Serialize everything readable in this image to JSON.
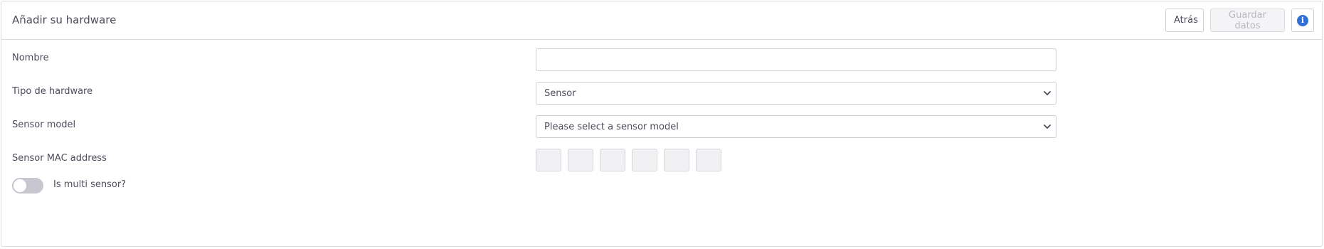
{
  "header": {
    "title": "Añadir su hardware",
    "back_label": "Atrás",
    "save_label": "Guardar datos",
    "info_glyph": "i"
  },
  "form": {
    "name_label": "Nombre",
    "name_value": "",
    "hardware_type_label": "Tipo de hardware",
    "hardware_type_value": "Sensor",
    "sensor_model_label": "Sensor model",
    "sensor_model_value": "Please select a sensor model",
    "mac_label": "Sensor MAC address",
    "mac_octets": [
      "",
      "",
      "",
      "",
      "",
      ""
    ],
    "multi_sensor_label": "Is multi sensor?",
    "multi_sensor_enabled": false
  },
  "colors": {
    "accent": "#2f6fd6",
    "border": "#cfcdd6",
    "text": "#4f4b5c",
    "disabled_text": "#b9b7c1"
  },
  "icons": {
    "info": "info-icon",
    "select_arrow": "chevron-down-icon"
  }
}
